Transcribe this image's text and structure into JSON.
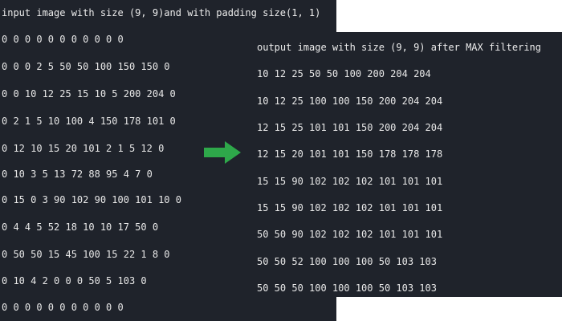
{
  "input": {
    "title": "input image with size (9, 9)and with padding size(1, 1)",
    "rows": [
      "0 0 0 0 0 0 0 0 0 0 0",
      "0 0 0 2 5 50 50 100 150 150 0",
      "0 0 10 12 25 15 10 5 200 204 0",
      "0 2 1 5 10 100 4 150 178 101 0",
      "0 12 10 15 20 101 2 1 5 12 0",
      "0 10 3 5 13 72 88 95 4 7 0",
      "0 15 0 3 90 102 90 100 101 10 0",
      "0 4 4 5 52 18 10 10 17 50 0",
      "0 50 50 15 45 100 15 22 1 8 0",
      "0 10 4 2 0 0 0 50 5 103 0",
      "0 0 0 0 0 0 0 0 0 0 0"
    ]
  },
  "output": {
    "title": "output image with size (9, 9) after MAX filtering",
    "rows": [
      "10 12 25 50 50 100 200 204 204",
      "10 12 25 100 100 150 200 204 204",
      "12 15 25 101 101 150 200 204 204",
      "12 15 20 101 101 150 178 178 178",
      "15 15 90 102 102 102 101 101 101",
      "15 15 90 102 102 102 101 101 101",
      "50 50 90 102 102 102 101 101 101",
      "50 50 52 100 100 100 50 103 103",
      "50 50 50 100 100 100 50 103 103"
    ]
  },
  "arrow_icon": "right-arrow-icon",
  "colors": {
    "panel_bg": "#1f232b",
    "text": "#e8e8e8",
    "arrow": "#2ea84a",
    "page_bg": "#ffffff"
  }
}
